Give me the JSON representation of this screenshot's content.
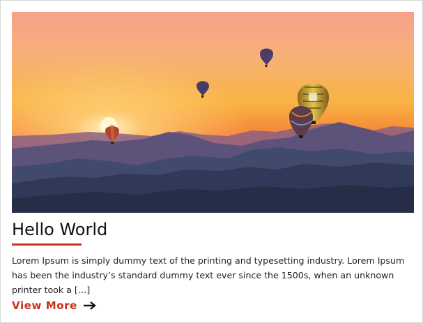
{
  "post": {
    "title": "Hello World",
    "excerpt": "Lorem Ipsum is simply dummy text of the printing and typesetting industry. Lorem Ipsum has been the industry’s standard dummy text ever since the 1500s, when an unknown printer took a […]",
    "read_more_label": "View More"
  },
  "icons": {
    "read_more": "arrow-right-icon"
  },
  "colors": {
    "accent": "#c8301a",
    "title": "#111111",
    "body_text": "#222222",
    "border": "#d6d6d6"
  }
}
